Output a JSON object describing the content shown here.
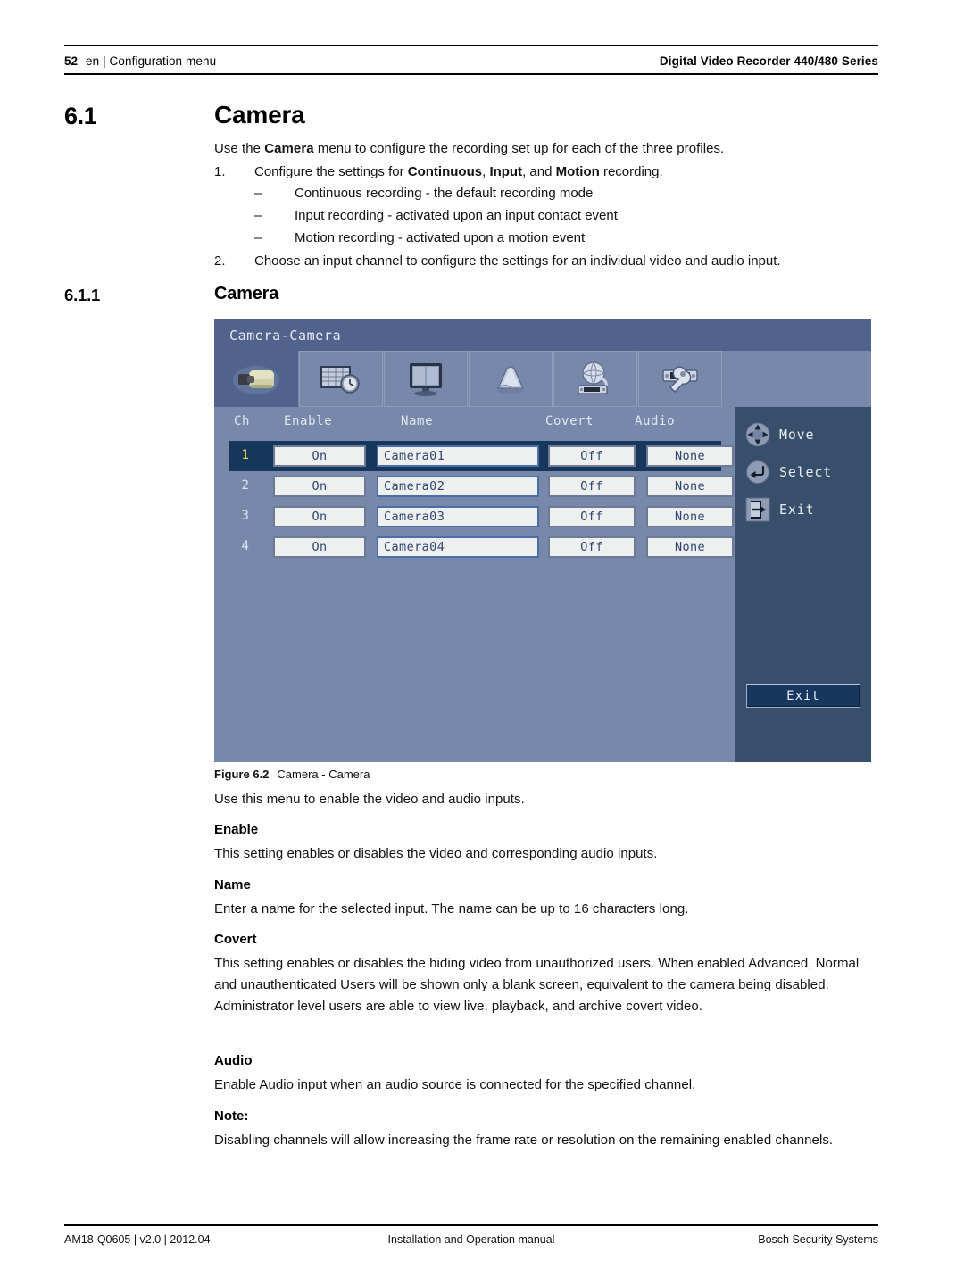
{
  "header": {
    "page_number": "52",
    "left": "en | Configuration menu",
    "right": "Digital Video Recorder 440/480 Series"
  },
  "section": {
    "number": "6.1",
    "title": "Camera",
    "intro_pre": "Use the ",
    "intro_bold": "Camera",
    "intro_post": " menu to configure the recording set up for each of the three profiles.",
    "step1": {
      "marker": "1.",
      "pre": "Configure the settings for ",
      "b1": "Continuous",
      "mid1": ", ",
      "b2": "Input",
      "mid2": ", and ",
      "b3": "Motion",
      "post": " recording."
    },
    "sub_items": [
      {
        "marker": "–",
        "text": "Continuous recording - the default recording mode"
      },
      {
        "marker": "–",
        "text": "Input recording - activated upon an input contact event"
      },
      {
        "marker": "–",
        "text": "Motion recording - activated upon a motion event"
      }
    ],
    "step2": {
      "marker": "2.",
      "text": "Choose an input channel to configure the settings for an individual video and audio input."
    }
  },
  "subsection": {
    "number": "6.1.1",
    "title": "Camera"
  },
  "screenshot": {
    "title": "Camera-Camera",
    "tabs": [
      {
        "name": "camera",
        "selected": true
      },
      {
        "name": "schedule",
        "selected": false
      },
      {
        "name": "display",
        "selected": false
      },
      {
        "name": "event",
        "selected": false
      },
      {
        "name": "network",
        "selected": false
      },
      {
        "name": "system",
        "selected": false
      }
    ],
    "table": {
      "columns": [
        "Ch",
        "Enable",
        "Name",
        "Covert",
        "Audio"
      ],
      "rows": [
        {
          "ch": "1",
          "enable": "On",
          "name": "Camera01",
          "covert": "Off",
          "audio": "None",
          "selected": true
        },
        {
          "ch": "2",
          "enable": "On",
          "name": "Camera02",
          "covert": "Off",
          "audio": "None",
          "selected": false
        },
        {
          "ch": "3",
          "enable": "On",
          "name": "Camera03",
          "covert": "Off",
          "audio": "None",
          "selected": false
        },
        {
          "ch": "4",
          "enable": "On",
          "name": "Camera04",
          "covert": "Off",
          "audio": "None",
          "selected": false
        }
      ]
    },
    "controls": [
      {
        "icon": "dpad-icon",
        "label": "Move"
      },
      {
        "icon": "enter-icon",
        "label": "Select"
      },
      {
        "icon": "exit-icon",
        "label": "Exit"
      }
    ],
    "exit_button": "Exit",
    "colors": {
      "title_bar": "#51638c",
      "panel_bg": "#7888aa",
      "side_bg": "#384f6b",
      "selected_row": "#16365c",
      "selected_ch_text": "#f2e03a",
      "field_bg": "#eef0ef",
      "field_text": "#2e4470",
      "exit_button_bg": "#17375e"
    }
  },
  "figure": {
    "label": "Figure 6.2",
    "caption": "Camera - Camera"
  },
  "descriptions": {
    "use_menu": "Use this menu to enable the video and audio inputs.",
    "enable_heading": "Enable",
    "enable_text": "This setting enables or disables the video and corresponding audio inputs.",
    "name_heading": "Name",
    "name_text": "Enter a name for the selected input. The name can be up to 16 characters long.",
    "covert_heading": "Covert",
    "covert_text": "This setting enables or disables the hiding video from unauthorized users. When enabled Advanced, Normal and unauthenticated Users will be shown only a blank screen, equivalent to the camera being disabled. Administrator level users are able to view live, playback, and archive covert video.",
    "audio_heading": "Audio",
    "audio_text": "Enable Audio input when an audio source is connected for the specified channel.",
    "note_heading": "Note:",
    "note_text": "Disabling channels will allow increasing the frame rate or resolution on the remaining enabled channels."
  },
  "footer": {
    "left": "AM18-Q0605 | v2.0 | 2012.04",
    "center": "Installation and Operation manual",
    "right": "Bosch Security Systems"
  }
}
